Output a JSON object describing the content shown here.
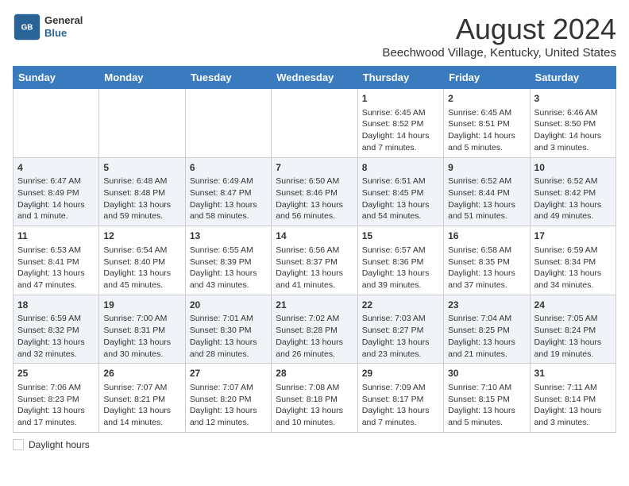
{
  "header": {
    "logo_general": "General",
    "logo_blue": "Blue",
    "title": "August 2024",
    "subtitle": "Beechwood Village, Kentucky, United States"
  },
  "columns": [
    "Sunday",
    "Monday",
    "Tuesday",
    "Wednesday",
    "Thursday",
    "Friday",
    "Saturday"
  ],
  "weeks": [
    [
      {
        "day": "",
        "info": ""
      },
      {
        "day": "",
        "info": ""
      },
      {
        "day": "",
        "info": ""
      },
      {
        "day": "",
        "info": ""
      },
      {
        "day": "1",
        "info": "Sunrise: 6:45 AM\nSunset: 8:52 PM\nDaylight: 14 hours and 7 minutes."
      },
      {
        "day": "2",
        "info": "Sunrise: 6:45 AM\nSunset: 8:51 PM\nDaylight: 14 hours and 5 minutes."
      },
      {
        "day": "3",
        "info": "Sunrise: 6:46 AM\nSunset: 8:50 PM\nDaylight: 14 hours and 3 minutes."
      }
    ],
    [
      {
        "day": "4",
        "info": "Sunrise: 6:47 AM\nSunset: 8:49 PM\nDaylight: 14 hours and 1 minute."
      },
      {
        "day": "5",
        "info": "Sunrise: 6:48 AM\nSunset: 8:48 PM\nDaylight: 13 hours and 59 minutes."
      },
      {
        "day": "6",
        "info": "Sunrise: 6:49 AM\nSunset: 8:47 PM\nDaylight: 13 hours and 58 minutes."
      },
      {
        "day": "7",
        "info": "Sunrise: 6:50 AM\nSunset: 8:46 PM\nDaylight: 13 hours and 56 minutes."
      },
      {
        "day": "8",
        "info": "Sunrise: 6:51 AM\nSunset: 8:45 PM\nDaylight: 13 hours and 54 minutes."
      },
      {
        "day": "9",
        "info": "Sunrise: 6:52 AM\nSunset: 8:44 PM\nDaylight: 13 hours and 51 minutes."
      },
      {
        "day": "10",
        "info": "Sunrise: 6:52 AM\nSunset: 8:42 PM\nDaylight: 13 hours and 49 minutes."
      }
    ],
    [
      {
        "day": "11",
        "info": "Sunrise: 6:53 AM\nSunset: 8:41 PM\nDaylight: 13 hours and 47 minutes."
      },
      {
        "day": "12",
        "info": "Sunrise: 6:54 AM\nSunset: 8:40 PM\nDaylight: 13 hours and 45 minutes."
      },
      {
        "day": "13",
        "info": "Sunrise: 6:55 AM\nSunset: 8:39 PM\nDaylight: 13 hours and 43 minutes."
      },
      {
        "day": "14",
        "info": "Sunrise: 6:56 AM\nSunset: 8:37 PM\nDaylight: 13 hours and 41 minutes."
      },
      {
        "day": "15",
        "info": "Sunrise: 6:57 AM\nSunset: 8:36 PM\nDaylight: 13 hours and 39 minutes."
      },
      {
        "day": "16",
        "info": "Sunrise: 6:58 AM\nSunset: 8:35 PM\nDaylight: 13 hours and 37 minutes."
      },
      {
        "day": "17",
        "info": "Sunrise: 6:59 AM\nSunset: 8:34 PM\nDaylight: 13 hours and 34 minutes."
      }
    ],
    [
      {
        "day": "18",
        "info": "Sunrise: 6:59 AM\nSunset: 8:32 PM\nDaylight: 13 hours and 32 minutes."
      },
      {
        "day": "19",
        "info": "Sunrise: 7:00 AM\nSunset: 8:31 PM\nDaylight: 13 hours and 30 minutes."
      },
      {
        "day": "20",
        "info": "Sunrise: 7:01 AM\nSunset: 8:30 PM\nDaylight: 13 hours and 28 minutes."
      },
      {
        "day": "21",
        "info": "Sunrise: 7:02 AM\nSunset: 8:28 PM\nDaylight: 13 hours and 26 minutes."
      },
      {
        "day": "22",
        "info": "Sunrise: 7:03 AM\nSunset: 8:27 PM\nDaylight: 13 hours and 23 minutes."
      },
      {
        "day": "23",
        "info": "Sunrise: 7:04 AM\nSunset: 8:25 PM\nDaylight: 13 hours and 21 minutes."
      },
      {
        "day": "24",
        "info": "Sunrise: 7:05 AM\nSunset: 8:24 PM\nDaylight: 13 hours and 19 minutes."
      }
    ],
    [
      {
        "day": "25",
        "info": "Sunrise: 7:06 AM\nSunset: 8:23 PM\nDaylight: 13 hours and 17 minutes."
      },
      {
        "day": "26",
        "info": "Sunrise: 7:07 AM\nSunset: 8:21 PM\nDaylight: 13 hours and 14 minutes."
      },
      {
        "day": "27",
        "info": "Sunrise: 7:07 AM\nSunset: 8:20 PM\nDaylight: 13 hours and 12 minutes."
      },
      {
        "day": "28",
        "info": "Sunrise: 7:08 AM\nSunset: 8:18 PM\nDaylight: 13 hours and 10 minutes."
      },
      {
        "day": "29",
        "info": "Sunrise: 7:09 AM\nSunset: 8:17 PM\nDaylight: 13 hours and 7 minutes."
      },
      {
        "day": "30",
        "info": "Sunrise: 7:10 AM\nSunset: 8:15 PM\nDaylight: 13 hours and 5 minutes."
      },
      {
        "day": "31",
        "info": "Sunrise: 7:11 AM\nSunset: 8:14 PM\nDaylight: 13 hours and 3 minutes."
      }
    ]
  ],
  "legend": {
    "daylight_label": "Daylight hours"
  }
}
